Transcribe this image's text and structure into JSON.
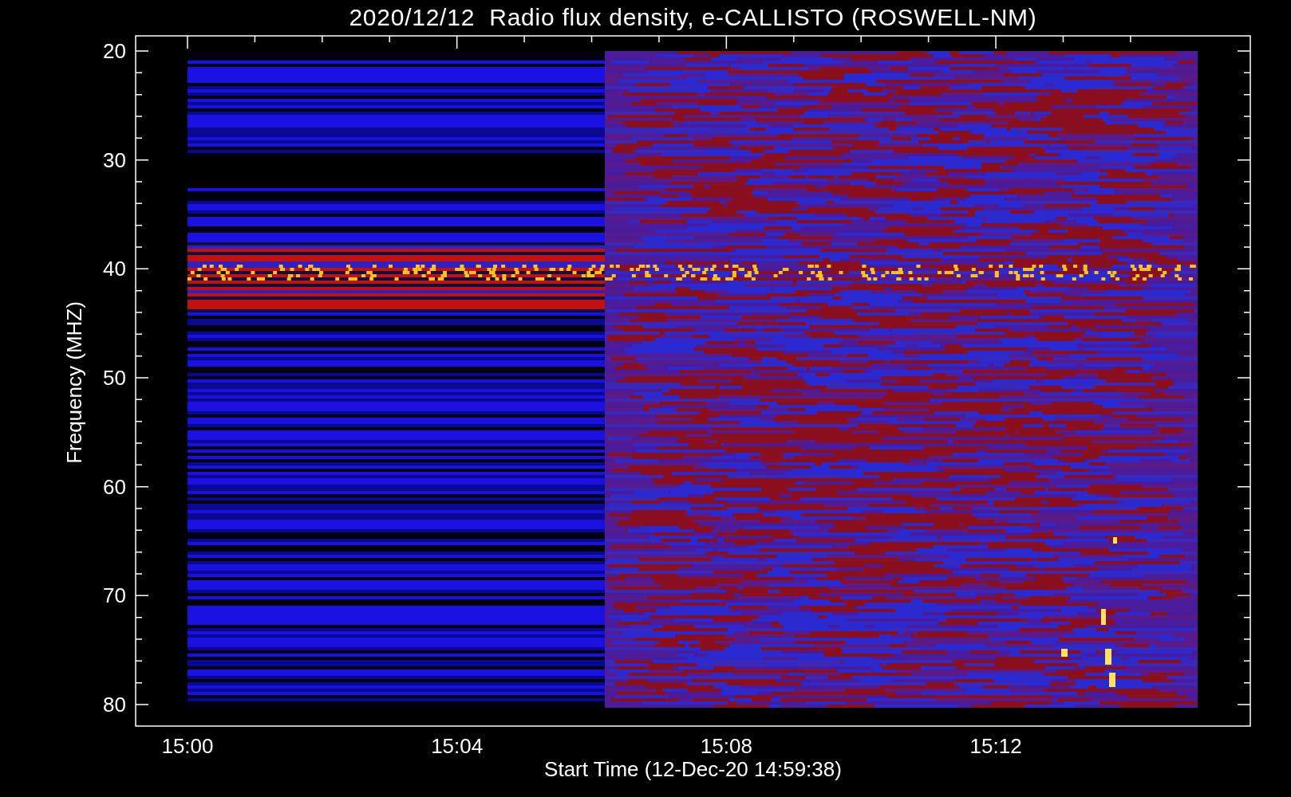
{
  "title": "2020/12/12  Radio flux density, e-CALLISTO (ROSWELL-NM)",
  "y_axis": {
    "label": "Frequency (MHZ)",
    "ticks": [
      "20",
      "30",
      "40",
      "50",
      "60",
      "70",
      "80"
    ]
  },
  "x_axis": {
    "label": "Start Time (12-Dec-20 14:59:38)",
    "ticks": [
      "15:00",
      "15:04",
      "15:08",
      "15:12"
    ]
  }
}
